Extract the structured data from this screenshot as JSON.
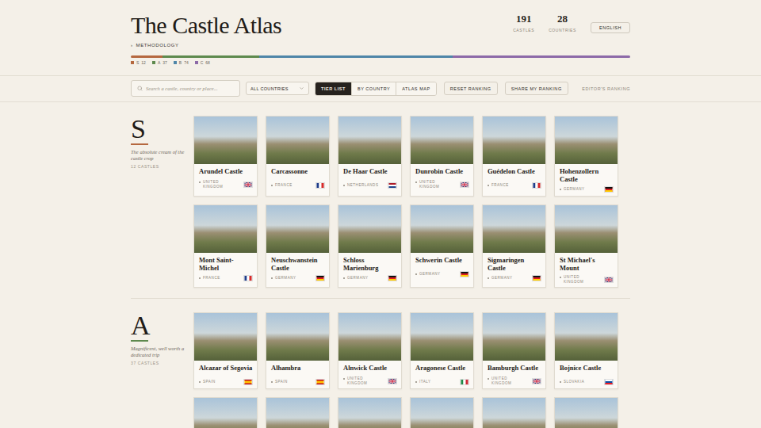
{
  "header": {
    "title": "The Castle Atlas",
    "methodology": {
      "marker": "›",
      "label": "METHODOLOGY"
    },
    "stats": [
      {
        "value": "191",
        "label": "CASTLES"
      },
      {
        "value": "28",
        "label": "COUNTRIES"
      }
    ],
    "language": "ENGLISH"
  },
  "distribution": [
    {
      "tier": "S",
      "count": "12",
      "level": 0.063,
      "color": "#b5683f"
    },
    {
      "tier": "A",
      "count": "37",
      "level": 0.194,
      "color": "#5e8a4e"
    },
    {
      "tier": "B",
      "count": "74",
      "level": 0.387,
      "color": "#4f86a8"
    },
    {
      "tier": "C",
      "count": "68",
      "level": 0.356,
      "color": "#8d6aa8"
    }
  ],
  "toolbar": {
    "search": {
      "placeholder": "Search a castle, country or place..."
    },
    "country_select": "ALL COUNTRIES",
    "views": [
      {
        "label": "TIER LIST",
        "selected": true
      },
      {
        "label": "BY COUNTRY",
        "selected": false
      },
      {
        "label": "ATLAS MAP",
        "selected": false
      }
    ],
    "actions": [
      "RESET RANKING",
      "SHARE MY RANKING"
    ],
    "editor_link": "EDITOR'S RANKING"
  },
  "tiers": [
    {
      "letter": "S",
      "color": "#b5683f",
      "description": "The absolute cream of the castle crop",
      "count_label": "12 CASTLES",
      "cut_cards": 0,
      "castles": [
        {
          "name": "Arundel Castle",
          "country": "UNITED KINGDOM",
          "flag": "gb"
        },
        {
          "name": "Carcassonne",
          "country": "FRANCE",
          "flag": "fr"
        },
        {
          "name": "De Haar Castle",
          "country": "NETHERLANDS",
          "flag": "nl"
        },
        {
          "name": "Dunrobin Castle",
          "country": "UNITED KINGDOM",
          "flag": "gb"
        },
        {
          "name": "Guédelon Castle",
          "country": "FRANCE",
          "flag": "fr"
        },
        {
          "name": "Hohenzollern Castle",
          "country": "GERMANY",
          "flag": "de"
        },
        {
          "name": "Mont Saint-Michel",
          "country": "FRANCE",
          "flag": "fr"
        },
        {
          "name": "Neuschwanstein Castle",
          "country": "GERMANY",
          "flag": "de"
        },
        {
          "name": "Schloss Marienburg",
          "country": "GERMANY",
          "flag": "de"
        },
        {
          "name": "Schwerin Castle",
          "country": "GERMANY",
          "flag": "de"
        },
        {
          "name": "Sigmaringen Castle",
          "country": "GERMANY",
          "flag": "de"
        },
        {
          "name": "St Michael's Mount",
          "country": "UNITED KINGDOM",
          "flag": "gb"
        }
      ]
    },
    {
      "letter": "A",
      "color": "#5e8a4e",
      "description": "Magnificent, well worth a dedicated trip",
      "count_label": "37 CASTLES",
      "cut_cards": 6,
      "castles": [
        {
          "name": "Alcazar of Segovia",
          "country": "SPAIN",
          "flag": "es"
        },
        {
          "name": "Alhambra",
          "country": "SPAIN",
          "flag": "es"
        },
        {
          "name": "Alnwick Castle",
          "country": "UNITED KINGDOM",
          "flag": "gb"
        },
        {
          "name": "Aragonese Castle",
          "country": "ITALY",
          "flag": "it"
        },
        {
          "name": "Bamburgh Castle",
          "country": "UNITED KINGDOM",
          "flag": "gb"
        },
        {
          "name": "Bojnice Castle",
          "country": "SLOVAKIA",
          "flag": "sk"
        }
      ]
    }
  ]
}
